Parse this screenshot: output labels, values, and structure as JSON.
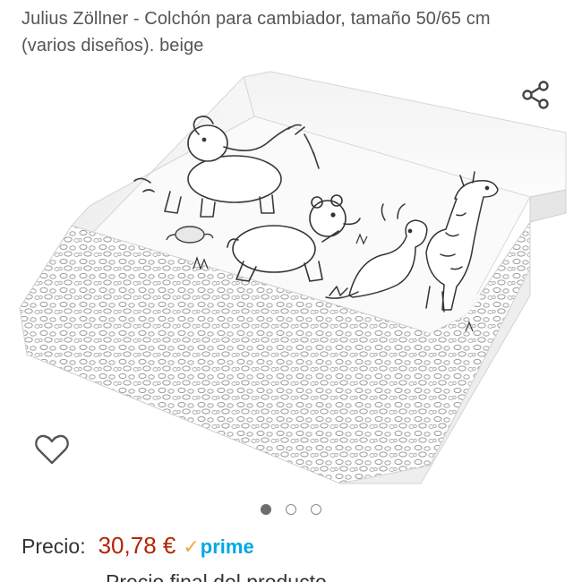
{
  "product": {
    "title": "Julius Zöllner - Colchón para cambiador, tamaño 50/65 cm (varios diseños). beige",
    "image_alt": "Colchón para cambiador blanco con dibujos de animales (elefante, oso, canguro, jirafa) y estampado de piedras grises"
  },
  "icons": {
    "share": "share-icon",
    "wishlist": "heart-outline-icon"
  },
  "carousel": {
    "total": 3,
    "active_index": 0
  },
  "pricing": {
    "label": "Precio:",
    "value": "30,78 €",
    "prime_check": "✓",
    "prime_label": "prime"
  },
  "next_line_partial": "Precio final del producto",
  "colors": {
    "price": "#b12704",
    "prime_blue": "#00a8e1",
    "prime_check": "#f3a847",
    "title_text": "#555555"
  }
}
